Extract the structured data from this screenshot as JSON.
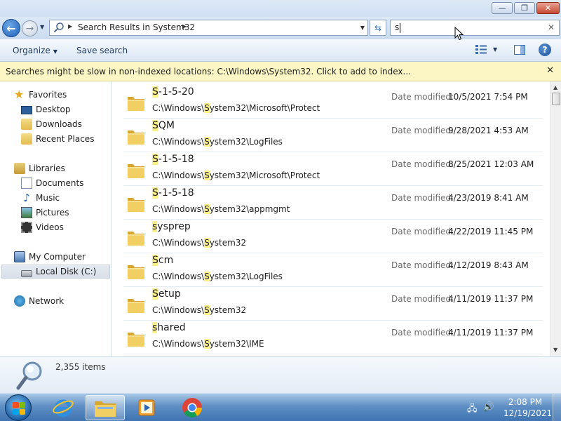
{
  "window": {
    "controls": {
      "minimize": "—",
      "maximize": "❐",
      "close": "✕"
    }
  },
  "address_bar": {
    "path_label": "Search Results in System32",
    "search_query": "s",
    "clear_glyph": "✕",
    "refresh_glyph": "⇆"
  },
  "toolbar": {
    "organize_label": "Organize",
    "save_search_label": "Save search",
    "help_glyph": "?"
  },
  "infobar": {
    "message": "Searches might be slow in non-indexed locations: C:\\Windows\\System32. Click to add to index...",
    "close_glyph": "✕"
  },
  "nav": {
    "favorites": {
      "label": "Favorites",
      "items": [
        "Desktop",
        "Downloads",
        "Recent Places"
      ]
    },
    "libraries": {
      "label": "Libraries",
      "items": [
        "Documents",
        "Music",
        "Pictures",
        "Videos"
      ]
    },
    "computer": {
      "label": "My Computer",
      "items": [
        "Local Disk (C:)"
      ]
    },
    "network": {
      "label": "Network"
    },
    "selected": "Local Disk (C:)"
  },
  "results": {
    "date_label": "Date modified:",
    "rows": [
      {
        "name_hl": "S",
        "name_rest": "-1-5-20",
        "path_pre": "C:\\Windows\\",
        "path_hl": "S",
        "path_post": "ystem32\\Microsoft\\Protect",
        "date": "10/5/2021 7:54 PM"
      },
      {
        "name_hl": "S",
        "name_rest": "QM",
        "path_pre": "C:\\Windows\\",
        "path_hl": "S",
        "path_post": "ystem32\\LogFiles",
        "date": "9/28/2021 4:53 AM"
      },
      {
        "name_hl": "S",
        "name_rest": "-1-5-18",
        "path_pre": "C:\\Windows\\",
        "path_hl": "S",
        "path_post": "ystem32\\Microsoft\\Protect",
        "date": "8/25/2021 12:03 AM"
      },
      {
        "name_hl": "S",
        "name_rest": "-1-5-18",
        "path_pre": "C:\\Windows\\",
        "path_hl": "S",
        "path_post": "ystem32\\appmgmt",
        "date": "4/23/2019 8:41 AM"
      },
      {
        "name_hl": "s",
        "name_rest": "ysprep",
        "path_pre": "C:\\Windows\\",
        "path_hl": "S",
        "path_post": "ystem32",
        "date": "4/22/2019 11:45 PM"
      },
      {
        "name_hl": "S",
        "name_rest": "cm",
        "path_pre": "C:\\Windows\\",
        "path_hl": "S",
        "path_post": "ystem32\\LogFiles",
        "date": "4/12/2019 8:43 AM"
      },
      {
        "name_hl": "S",
        "name_rest": "etup",
        "path_pre": "C:\\Windows\\",
        "path_hl": "S",
        "path_post": "ystem32",
        "date": "4/11/2019 11:37 PM"
      },
      {
        "name_hl": "s",
        "name_rest": "hared",
        "path_pre": "C:\\Windows\\",
        "path_hl": "S",
        "path_post": "ystem32\\IME",
        "date": "4/11/2019 11:37 PM"
      }
    ]
  },
  "details": {
    "item_count": "2,355 items"
  },
  "taskbar": {
    "apps": [
      "internet-explorer",
      "windows-explorer",
      "windows-media-player",
      "google-chrome"
    ],
    "active_app": "windows-explorer",
    "clock_time": "2:08 PM",
    "clock_date": "12/19/2021"
  },
  "colors": {
    "highlight": "#fbf08a",
    "infobar_bg": "#fbf6c4",
    "taskbar": "#3f74b2",
    "folder": "#e8c35a"
  }
}
